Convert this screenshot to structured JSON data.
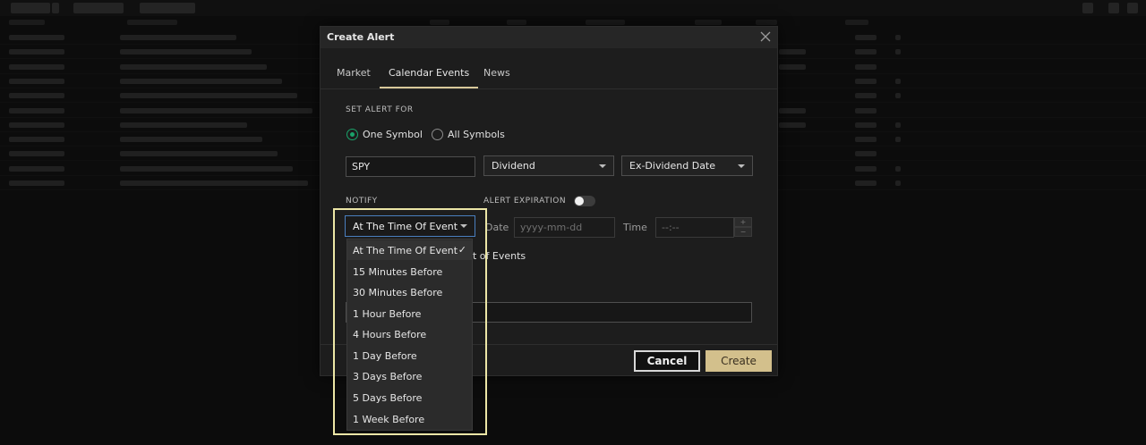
{
  "modal": {
    "title": "Create Alert",
    "tabs": [
      {
        "label": "Market"
      },
      {
        "label": "Calendar Events"
      },
      {
        "label": "News"
      }
    ],
    "set_alert_for_label": "SET ALERT FOR",
    "radio_one_symbol": "One Symbol",
    "radio_all_symbols": "All Symbols",
    "selected_radio": "One Symbol",
    "symbol_value": "SPY",
    "event_type_value": "Dividend",
    "event_subtype_value": "Ex-Dividend Date",
    "notify_label": "NOTIFY",
    "alert_expiration_label": "ALERT EXPIRATION",
    "alert_expiration_on": false,
    "notify_value": "At The Time Of Event",
    "date_label": "Date",
    "date_placeholder": "yyyy-mm-dd",
    "time_label": "Time",
    "time_placeholder": "--:--",
    "events_text_fragment": "t of Events",
    "cancel_label": "Cancel",
    "create_label": "Create"
  },
  "notify_options": [
    "At The Time Of Event",
    "15 Minutes Before",
    "30 Minutes Before",
    "1 Hour Before",
    "4 Hours Before",
    "1 Day Before",
    "3 Days Before",
    "5 Days Before",
    "1 Week Before"
  ],
  "colors": {
    "accent": "#d3c08c",
    "radio_on": "#1aa36a",
    "highlight": "#ece6a6",
    "focus": "#4a7fbf"
  }
}
